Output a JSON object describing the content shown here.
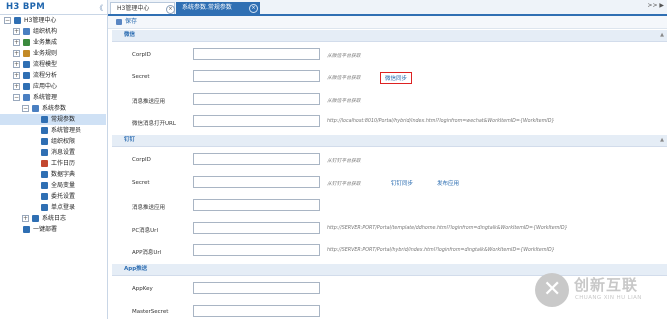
{
  "app": {
    "logo": "H3 BPM",
    "collapse": "《"
  },
  "tree": [
    {
      "label": "H3管理中心",
      "expander": "⊟",
      "icon_color": "#2f6fb3"
    },
    {
      "label": "组织机构",
      "expander": "⊞",
      "icon_color": "#4a7fc1"
    },
    {
      "label": "业务集成",
      "expander": "⊞",
      "icon_color": "#3b8a3e"
    },
    {
      "label": "业务规则",
      "expander": "⊞",
      "icon_color": "#c38a26"
    },
    {
      "label": "流程模型",
      "expander": "⊞",
      "icon_color": "#2f6fb3"
    },
    {
      "label": "流程分析",
      "expander": "⊞",
      "icon_color": "#2f6fb3"
    },
    {
      "label": "应用中心",
      "expander": "⊞",
      "icon_color": "#2f6fb3"
    },
    {
      "label": "系统管理",
      "expander": "⊟",
      "icon_color": "#4a7fc1"
    },
    {
      "label": "系统参数",
      "expander": "⊟",
      "icon_color": "#4a7fc1"
    },
    {
      "label": "常规参数",
      "expander": "",
      "icon_color": "#2f6fb3"
    },
    {
      "label": "系统管理员",
      "expander": "",
      "icon_color": "#2f6fb3"
    },
    {
      "label": "组织权限",
      "expander": "",
      "icon_color": "#2f6fb3"
    },
    {
      "label": "消息设置",
      "expander": "",
      "icon_color": "#2f6fb3"
    },
    {
      "label": "工作日历",
      "expander": "",
      "icon_color": "#c3472f"
    },
    {
      "label": "数据字典",
      "expander": "",
      "icon_color": "#2f6fb3"
    },
    {
      "label": "全局变量",
      "expander": "",
      "icon_color": "#2f6fb3"
    },
    {
      "label": "委托设置",
      "expander": "",
      "icon_color": "#2f6fb3"
    },
    {
      "label": "单点登录",
      "expander": "",
      "icon_color": "#2f6fb3"
    },
    {
      "label": "系统日志",
      "expander": "⊞",
      "icon_color": "#2f6fb3"
    },
    {
      "label": "一键部署",
      "expander": "",
      "icon_color": "#2f6fb3"
    }
  ],
  "tabs": [
    {
      "label": "H3管理中心",
      "close": "×"
    },
    {
      "label": "系统参数.常规参数",
      "close": "×"
    }
  ],
  "tab_nav": ">> ▶",
  "toolbar": {
    "save_label": "保存"
  },
  "sections": {
    "wechat": "微信",
    "dingtalk": "钉钉",
    "app_push": "App推送",
    "collapse_glyph": "▲"
  },
  "wechat": {
    "corpid_label": "CorpID",
    "corpid_hint": "从微信平台获取",
    "secret_label": "Secret",
    "secret_hint": "从微信平台获取",
    "sync_button": "微信同步",
    "msg_app_label": "消息推送应用",
    "msg_app_hint": "从微信平台获取",
    "msg_url_label": "微信消息打开URL",
    "msg_url_hint": "http://localhost:8010/Portal/hybrid/index.html?loginfrom=wechat&WorkItemID={WorkItemID}"
  },
  "dingtalk": {
    "corpid_label": "CorpID",
    "corpid_hint": "从钉钉平台获取",
    "secret_label": "Secret",
    "secret_hint": "从钉钉平台获取",
    "sync_button": "钉钉同步",
    "publish_button": "发布应用",
    "msg_app_label": "消息推送应用",
    "pc_url_label": "PC消息Url",
    "pc_url_hint": "http://SERVER:PORT/Portal/template/ddhome.html?loginfrom=dingtalk&WorkItemID={WorkItemID}",
    "app_url_label": "APP消息Url",
    "app_url_hint": "http://SERVER:PORT/Portal/hybrid/index.html?loginfrom=dingtalk&WorkItemID={WorkItemID}"
  },
  "app_push": {
    "appkey_label": "AppKey",
    "master_label": "MasterSecret"
  },
  "watermark": {
    "cn": "创新互联",
    "en": "CHUANG XIN HU LIAN",
    "glyph": "✕"
  }
}
